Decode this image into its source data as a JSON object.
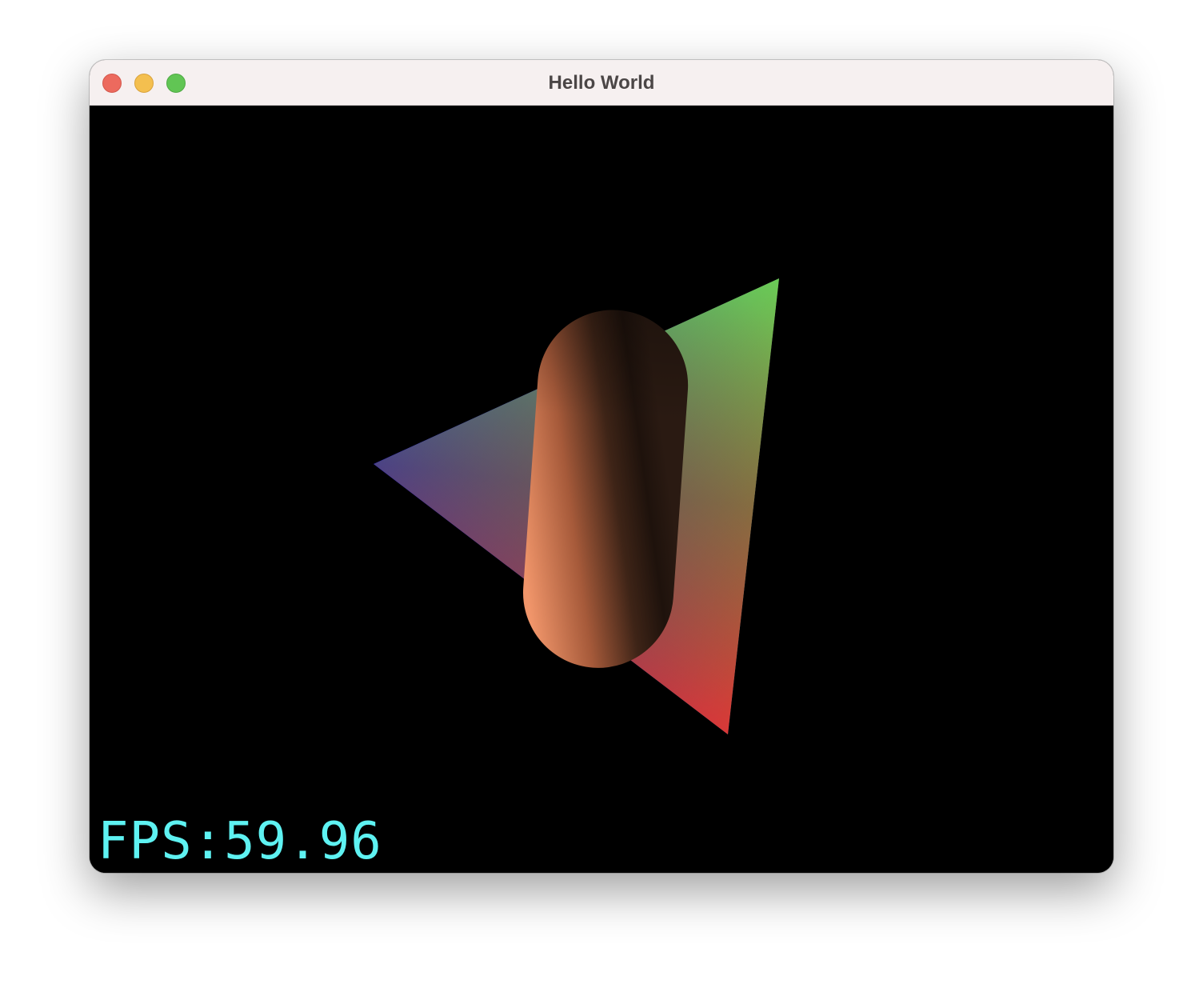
{
  "window": {
    "title": "Hello World"
  },
  "titlebar": {
    "buttons": [
      {
        "name": "close",
        "color": "#ec6a5e"
      },
      {
        "name": "minimize",
        "color": "#f4bf4f"
      },
      {
        "name": "zoom",
        "color": "#61c554"
      }
    ]
  },
  "scene": {
    "background": "#000000",
    "triangle": {
      "vertex_colors": [
        "#0000ff",
        "#66ff44",
        "#ff2a1e"
      ]
    },
    "capsule": {
      "color": "#f0956a",
      "shadow_color": "#1e120c"
    }
  },
  "overlay": {
    "fps_text": "FPS:59.96",
    "fps_color": "#5ef2f2"
  }
}
